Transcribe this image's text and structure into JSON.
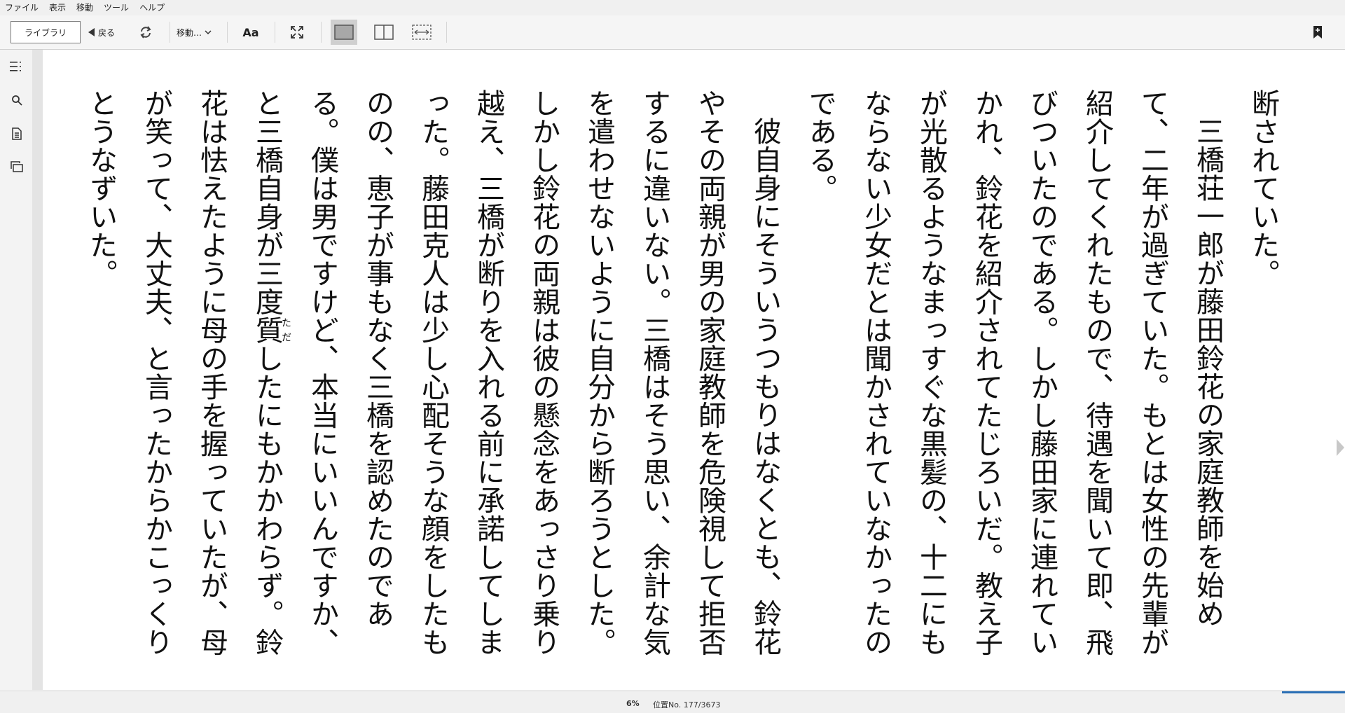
{
  "menu": [
    "ファイル",
    "表示",
    "移動",
    "ツール",
    "ヘルプ"
  ],
  "toolbar": {
    "library": "ライブラリ",
    "back": "戻る",
    "goto": "移動…",
    "font": "Aa"
  },
  "book": {
    "paragraphs": [
      {
        "indent": false,
        "text": "断されていた。"
      },
      {
        "indent": true,
        "text": "三橋荘一郎が藤田鈴花の家庭教師を始めて、二年が過ぎていた。もとは女性の先輩が紹介してくれたもので、待遇を聞いて即、飛びついたのである。しかし藤田家に連れていかれ、鈴花を紹介されてたじろいだ。教え子が光散るようなまっすぐな黒髪の、十二にもならない少女だとは聞かされていなかったのである。"
      },
      {
        "indent": true,
        "text": "彼自身にそういうつもりはなくとも、鈴花やその両親が男の家庭教師を危険視して拒否するに違いない。三橋はそう思い、余計な気を遣わせないように自分から断ろうとした。しかし鈴花の両親は彼の懸念をあっさり乗り越え、三橋が断りを入れる前に承諾してしまった。藤田克人は少し心配そうな顔をしたものの、恵子が事もなく三橋を認めたのである。僕は男ですけど、本当にいいんですか、と三橋自身が三度質したにもかかわらず。鈴花は怯えたように母の手を握っていたが、母が笑って、大丈夫、と言ったからかこっくりとうなずいた。"
      }
    ],
    "ruby": {
      "base": "質",
      "reading": "ただ"
    }
  },
  "status": {
    "percent": "6%",
    "location": "位置No. 177/3673",
    "progress": 0.06
  }
}
